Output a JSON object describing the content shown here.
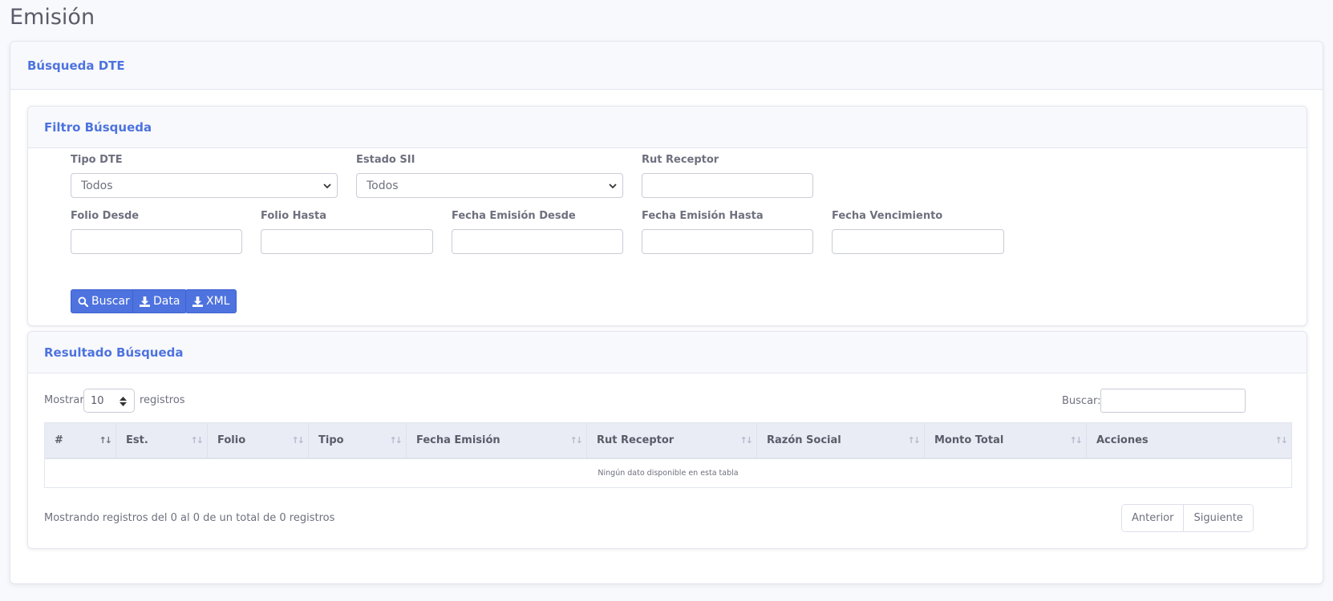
{
  "page": {
    "title": "Emisión"
  },
  "outer_card": {
    "title": "Búsqueda DTE"
  },
  "filter": {
    "title": "Filtro Búsqueda",
    "tipo_dte": {
      "label": "Tipo DTE",
      "value": "Todos"
    },
    "estado_sii": {
      "label": "Estado SII",
      "value": "Todos"
    },
    "rut_receptor": {
      "label": "Rut Receptor",
      "value": ""
    },
    "folio_desde": {
      "label": "Folio Desde",
      "value": ""
    },
    "folio_hasta": {
      "label": "Folio Hasta",
      "value": ""
    },
    "fecha_emision_desde": {
      "label": "Fecha Emisión Desde",
      "value": ""
    },
    "fecha_emision_hasta": {
      "label": "Fecha Emisión Hasta",
      "value": ""
    },
    "fecha_vencimiento": {
      "label": "Fecha Vencimiento",
      "value": ""
    },
    "buttons": {
      "buscar": "Buscar",
      "data": "Data",
      "xml": "XML"
    }
  },
  "results": {
    "title": "Resultado Búsqueda",
    "length": {
      "prefix": "Mostrar",
      "value": "10",
      "suffix": "registros"
    },
    "search_label": "Buscar:",
    "columns": [
      "#",
      "Est.",
      "Folio",
      "Tipo",
      "Fecha Emisión",
      "Rut Receptor",
      "Razón Social",
      "Monto Total",
      "Acciones"
    ],
    "empty_message": "Ningún dato disponible en esta tabla",
    "info": "Mostrando registros del 0 al 0 de un total de 0 registros",
    "pager": {
      "prev": "Anterior",
      "next": "Siguiente"
    }
  },
  "colors": {
    "accent": "#4e73df",
    "text": "#5a5c69",
    "background": "#f8f9fc"
  },
  "icons": {
    "buscar": "search-icon",
    "data": "download-icon",
    "xml": "download-icon",
    "sort": "sort-icon"
  }
}
